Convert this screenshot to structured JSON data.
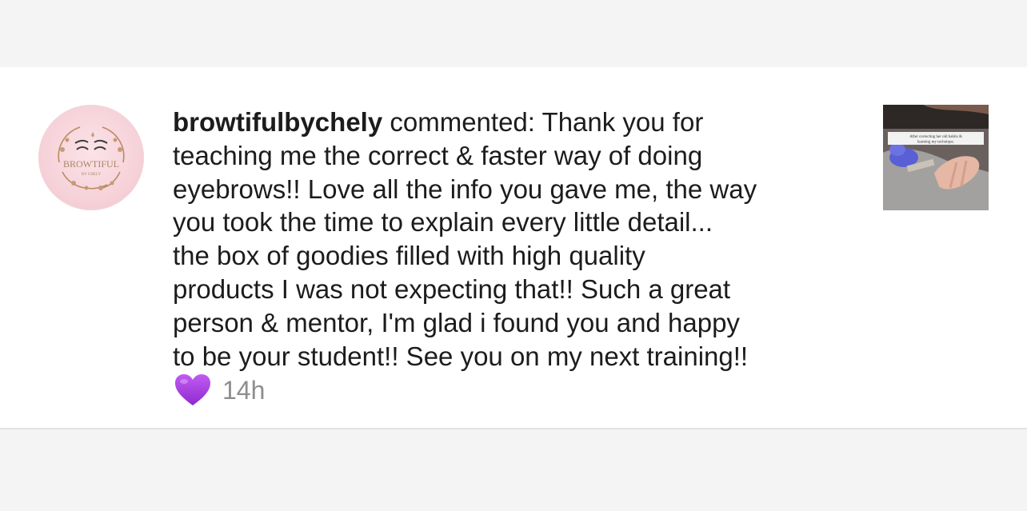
{
  "notification": {
    "username": "browtifulbychely",
    "action": " commented: ",
    "lines": [
      "Thank you for",
      "teaching me the correct & faster way of doing",
      "eyebrows!! Love all the info you gave me, the way",
      "you took the time to explain every little detail...",
      "the box of goodies filled with high quality",
      "products I was not expecting that!! Such a great",
      "person & mentor, I'm  glad i found you and happy",
      "to be your student!! See you on my next training!!"
    ],
    "reaction_icon": "purple-heart-icon",
    "timestamp": "14h"
  },
  "avatar": {
    "logo_text": "BROWTIFUL",
    "logo_subtext": "BY CHELY"
  },
  "thumbnail": {
    "caption_line1": "After correcting her old habits &",
    "caption_line2": "learning my technique."
  },
  "colors": {
    "heart": "#a63ce0",
    "timestamp": "#8e8e8e",
    "text": "#1c1c1c",
    "avatar_bg": "#f6d2d9",
    "logo_gold": "#b98b63"
  }
}
